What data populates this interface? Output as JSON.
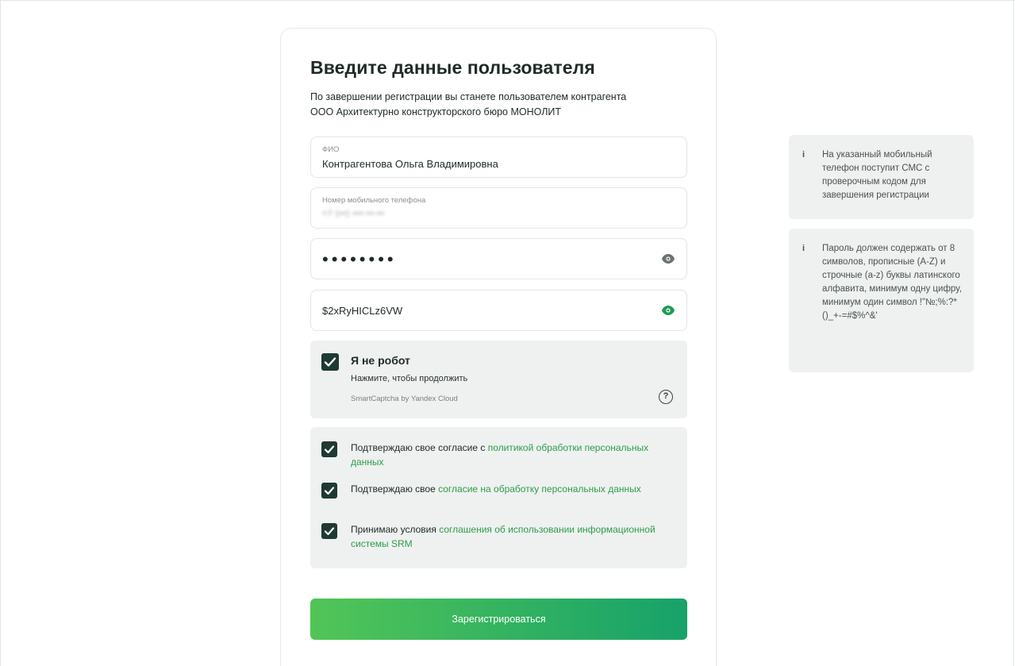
{
  "form": {
    "title": "Введите данные пользователя",
    "subtitle_line1": "По завершении регистрации вы станете пользователем контрагента",
    "subtitle_line2": "ООО Архитектурно конструкторского бюро МОНОЛИТ",
    "fio_label": "ФИО",
    "fio_value": "Контрагентова Ольга Владимировна",
    "phone_label": "Номер мобильного телефона",
    "phone_value": "+7 (••) •••-••-••",
    "password_masked": "••••••••",
    "password_confirm_value": "$2xRyHICLz6VW",
    "submit_label": "Зарегистрироваться"
  },
  "captcha": {
    "title": "Я не робот",
    "subtitle": "Нажмите, чтобы продолжить",
    "brand": "SmartCaptcha by Yandex Cloud",
    "help_symbol": "?"
  },
  "agreements": [
    {
      "prefix": "Подтверждаю свое согласие с ",
      "link": "политикой обработки персональных данных",
      "suffix": ""
    },
    {
      "prefix": "Подтверждаю свое ",
      "link": "согласие на обработку персональных данных",
      "suffix": ""
    },
    {
      "prefix": "Принимаю условия ",
      "link": "соглашения об использовании информационной системы SRM",
      "suffix": ""
    }
  ],
  "info": {
    "icon_symbol": "i",
    "sms_text": "На указанный мобильный телефон поступит СМС с проверочным кодом для завершения регистрации",
    "password_text": "Пароль должен содержать от 8 символов, прописные (A-Z) и строчные (a-z) буквы латинского алфавита, минимум одну цифру, минимум один символ !\"№;%:?*()_+-=#$%^&'"
  },
  "colors": {
    "accent_green": "#2e9d4a",
    "checkbox_dark": "#1e3a33",
    "eye_active": "#1e9a55",
    "eye_inactive": "#6b7270",
    "panel_bg": "#eef1f0"
  },
  "icons": {
    "eye": "eye-icon",
    "check": "check-icon",
    "help": "help-circle-icon",
    "info": "info-icon"
  }
}
